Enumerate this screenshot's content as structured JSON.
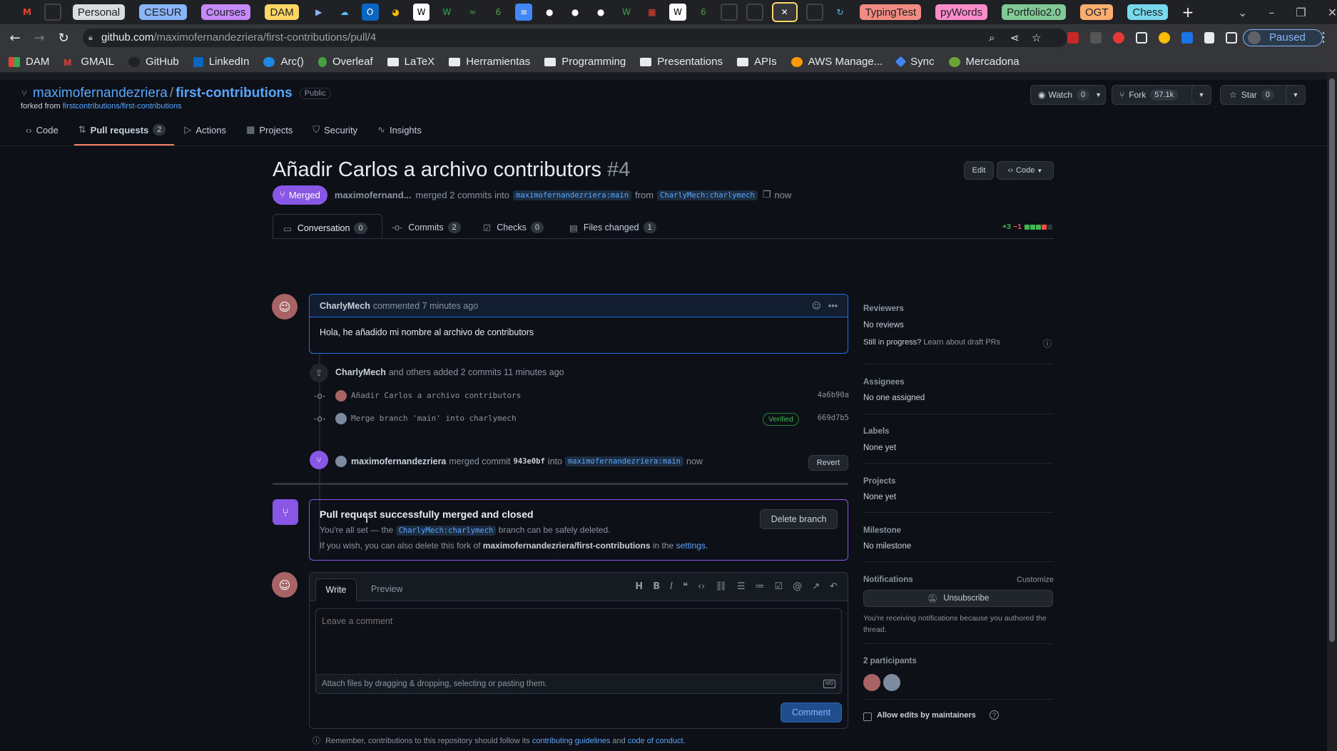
{
  "browser": {
    "tab_groups": [
      "Personal",
      "CESUR",
      "Courses",
      "DAM",
      "TypingTest",
      "pyWords",
      "Portfolio2.0",
      "OGT",
      "Chess"
    ],
    "url_host": "github.com",
    "url_path": "/maximofernandezriera/first-contributions/pull/4",
    "profile_status": "Paused",
    "bookmarks": [
      "DAM",
      "GMAIL",
      "GitHub",
      "LinkedIn",
      "Arc()",
      "Overleaf",
      "LaTeX",
      "Herramientas",
      "Programming",
      "Presentations",
      "APIs",
      "AWS Manage...",
      "Sync",
      "Mercadona"
    ]
  },
  "repo": {
    "owner": "maximofernandezriera",
    "separator": "/",
    "name": "first-contributions",
    "visibility": "Public",
    "forked_prefix": "forked from",
    "forked_from": "firstcontributions/first-contributions",
    "watch_label": "Watch",
    "watch_count": "0",
    "fork_label": "Fork",
    "fork_count": "57.1k",
    "star_label": "Star",
    "star_count": "0",
    "tabs": [
      {
        "label": "Code",
        "count": ""
      },
      {
        "label": "Pull requests",
        "count": "2"
      },
      {
        "label": "Actions",
        "count": ""
      },
      {
        "label": "Projects",
        "count": ""
      },
      {
        "label": "Security",
        "count": ""
      },
      {
        "label": "Insights",
        "count": ""
      }
    ]
  },
  "pr": {
    "title": "Añadir Carlos a archivo contributors",
    "number": "#4",
    "edit_label": "Edit",
    "code_label": "Code",
    "state": "Merged",
    "merger": "maximofernand...",
    "merged_text": "merged 2 commits into",
    "base_branch": "maximofernandezriera:main",
    "from_text": "from",
    "head_branch": "CharlyMech:charlymech",
    "time": "now",
    "tabs": [
      {
        "label": "Conversation",
        "count": "0"
      },
      {
        "label": "Commits",
        "count": "2"
      },
      {
        "label": "Checks",
        "count": "0"
      },
      {
        "label": "Files changed",
        "count": "1"
      }
    ],
    "diff_add": "+3",
    "diff_del": "−1"
  },
  "comment": {
    "author": "CharlyMech",
    "meta": "commented 7 minutes ago",
    "body": "Hola, he añadido mi nombre al archivo de contributors"
  },
  "commits_event": {
    "author": "CharlyMech",
    "text": "and others added 2 commits 11 minutes ago",
    "commits": [
      {
        "message": "Añadir Carlos a archivo contributors",
        "sha": "4a6b90a",
        "verified": ""
      },
      {
        "message": "Merge branch 'main' into charlymech",
        "sha": "669d7b5",
        "verified": "Verified"
      }
    ]
  },
  "merge_event": {
    "author": "maximofernandezriera",
    "text": "merged commit",
    "sha": "943e0bf",
    "into": "into",
    "branch": "maximofernandezriera:main",
    "time": "now",
    "revert_label": "Revert"
  },
  "merged_box": {
    "title": "Pull request successfully merged and closed",
    "line1_a": "You're all set — the",
    "line1_branch": "CharlyMech:charlymech",
    "line1_b": "branch can be safely deleted.",
    "line2_a": "If you wish, you can also delete this fork of",
    "line2_repo": "maximofernandezriera/first-contributions",
    "line2_b": "in the",
    "line2_link": "settings.",
    "delete_label": "Delete branch"
  },
  "editor": {
    "write_tab": "Write",
    "preview_tab": "Preview",
    "placeholder": "Leave a comment",
    "attach_hint": "Attach files by dragging & dropping, selecting or pasting them.",
    "md_badge": "MD",
    "submit_label": "Comment",
    "footer_a": "Remember, contributions to this repository should follow its",
    "footer_link1": "contributing guidelines",
    "footer_and": "and",
    "footer_link2": "code of conduct."
  },
  "sidebar": {
    "reviewers_title": "Reviewers",
    "reviewers_value": "No reviews",
    "draft_q": "Still in progress?",
    "draft_link": "Learn about draft PRs",
    "assignees_title": "Assignees",
    "assignees_value": "No one assigned",
    "labels_title": "Labels",
    "labels_value": "None yet",
    "projects_title": "Projects",
    "projects_value": "None yet",
    "milestone_title": "Milestone",
    "milestone_value": "No milestone",
    "notifications_title": "Notifications",
    "customize_label": "Customize",
    "unsubscribe_label": "Unsubscribe",
    "notif_reason": "You're receiving notifications because you authored the thread.",
    "participants_title": "2 participants",
    "allow_edits_label": "Allow edits by maintainers"
  }
}
